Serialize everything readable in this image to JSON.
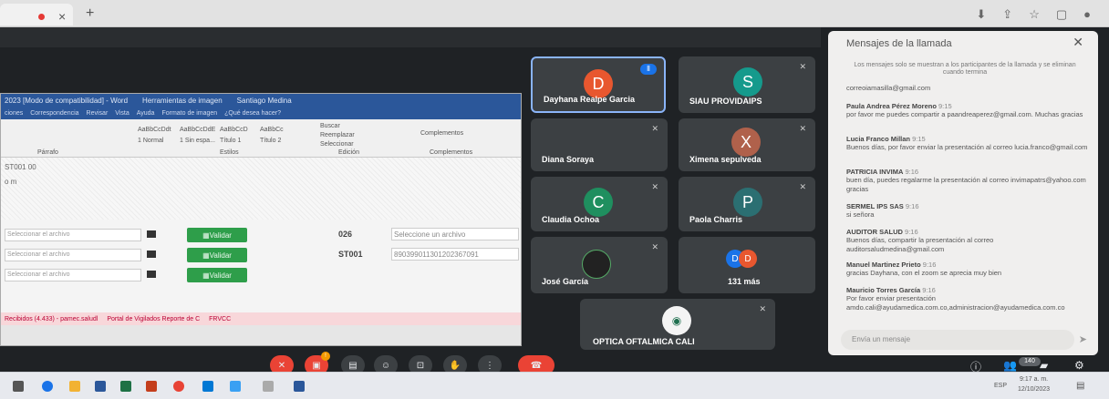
{
  "browser": {
    "tab_close": "×",
    "new_tab": "+"
  },
  "shared_screen": {
    "word_title": "2023 [Modo de compatibilidad] - Word",
    "word_tools": "Herramientas de imagen",
    "word_user": "Santiago Medina",
    "word_menu": [
      "ciones",
      "Correspondencia",
      "Revisar",
      "Vista",
      "Ayuda",
      "Formato de imagen",
      "¿Qué desea hacer?"
    ],
    "ribbon": {
      "styles": [
        "AaBbCcDdt",
        "AaBbCcDdE",
        "AaBbCcD",
        "AaBbCc"
      ],
      "style_names": [
        "1 Normal",
        "1 Sin espa...",
        "Título 1",
        "Título 2"
      ],
      "group_estilos": "Estilos",
      "group_edicion": "Edición",
      "group_complementos": "Complementos",
      "buscar": "Buscar",
      "reemplazar": "Reemplazar",
      "seleccionar": "Seleccionar",
      "complementos": "Complementos",
      "parrafo": "Párrafo"
    },
    "doc_text_1": "ST001 00",
    "doc_text_2": "o m",
    "rows": [
      {
        "placeholder": "Seleccionar el archivo",
        "button": "Validar",
        "code": "026",
        "field": "Seleccione un archivo"
      },
      {
        "placeholder": "Seleccionar el archivo",
        "button": "Validar",
        "code": "ST001",
        "field": "890399011301202367091"
      },
      {
        "placeholder": "Seleccionar el archivo",
        "button": "Validar",
        "code": "",
        "field": ""
      }
    ],
    "inner_tabs": [
      "Recibidos (4.433) - pamec.saludl",
      "Portal de Vigilados Reporte de C",
      "FRVCC"
    ]
  },
  "tiles": [
    {
      "name": "Dayhana Realpe Garcia",
      "initial": "D",
      "color": "#e8572f",
      "active": true
    },
    {
      "name": "SIAU PROVIDAIPS",
      "initial": "S",
      "color": "#159a8c"
    },
    {
      "name": "Diana Soraya",
      "initial": ""
    },
    {
      "name": "Ximena sepulveda",
      "initial": "X",
      "color": "#b0614b"
    },
    {
      "name": "Claudia Ochoa",
      "initial": "C",
      "color": "#1f8f5f"
    },
    {
      "name": "Paola Charris",
      "initial": "P",
      "color": "#2b6f72"
    },
    {
      "name": "José García",
      "initial": ""
    },
    {
      "name": "131 más",
      "initial": ""
    },
    {
      "name": "OPTICA OFTALMICA CALI",
      "initial": ""
    }
  ],
  "chat": {
    "title": "Mensajes de la llamada",
    "notice": "Los mensajes solo se muestran a los participantes de la llamada y se eliminan cuando termina",
    "messages": [
      {
        "sender": "",
        "time": "",
        "text": "correoiamasilla@gmail.com"
      },
      {
        "sender": "Paula Andrea Pérez Moreno",
        "time": "9:15",
        "text": "por favor me puedes compartir a paandreaperez@gmail.com. Muchas gracias"
      },
      {
        "sender": "Lucia Franco Millan",
        "time": "9:15",
        "text": "Buenos días, por favor enviar la presentación al correo lucia.franco@gmail.com"
      },
      {
        "sender": "PATRICIA INVIMA",
        "time": "9:16",
        "text": "buen día, puedes regalarme la presentación al correo invimapatrs@yahoo.com gracias"
      },
      {
        "sender": "SERMEL IPS SAS",
        "time": "9:16",
        "text": "si señora"
      },
      {
        "sender": "AUDITOR SALUD",
        "time": "9:16",
        "text": "Buenos días, compartir la presentación al correo auditorsaludmedina@gmail.com"
      },
      {
        "sender": "Manuel Martinez Prieto",
        "time": "9:16",
        "text": "gracias Dayhana, con el zoom se aprecia muy bien"
      },
      {
        "sender": "Mauricio Torres García",
        "time": "9:16",
        "text": "Por favor enviar presentación amdo.cali@ayudamedica.com.co,administracion@ayudamedica.com.co"
      }
    ],
    "input_placeholder": "Envía un mensaje"
  },
  "controls": {
    "participants_count": "140",
    "clock_time": "9:17 a. m.",
    "clock_date": "12/10/2023",
    "lang": "ESP"
  }
}
